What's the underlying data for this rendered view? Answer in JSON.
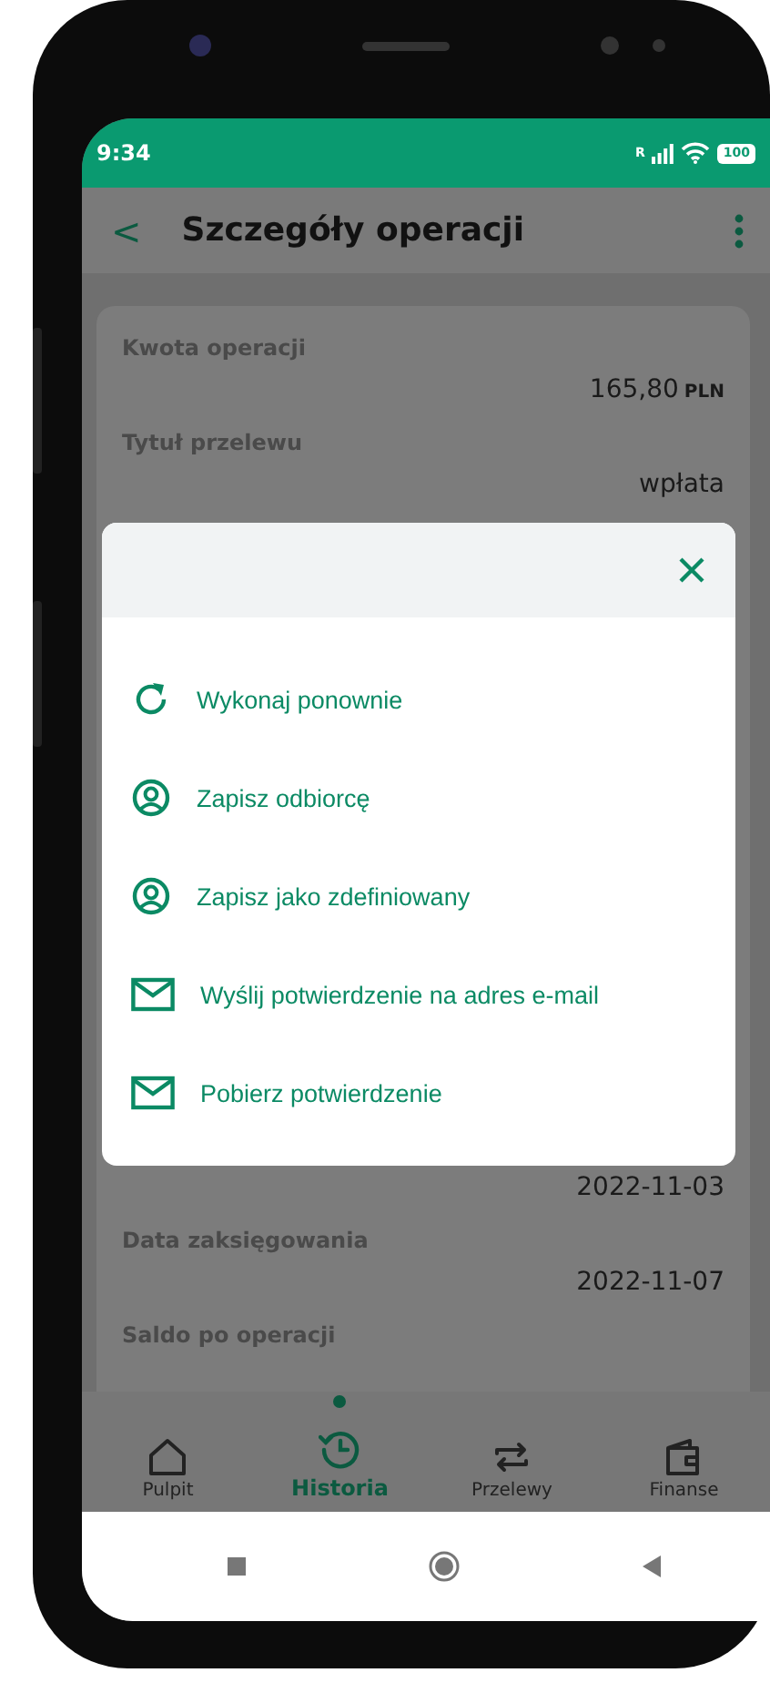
{
  "status_bar": {
    "time": "9:34",
    "roaming": "R",
    "battery": "100"
  },
  "app_bar": {
    "back": "<",
    "title": "Szczegóły operacji"
  },
  "details": [
    {
      "label": "Kwota operacji",
      "amount": "165,80",
      "currency": "PLN"
    },
    {
      "label": "Tytuł przelewu",
      "value": "wpłata"
    }
  ],
  "details_below": [
    {
      "value": "2022-11-03"
    },
    {
      "label": "Data zaksięgowania",
      "value": "2022-11-07"
    },
    {
      "label": "Saldo po operacji"
    }
  ],
  "dialog": {
    "items": [
      {
        "kind": "repeat",
        "label": "Wykonaj ponownie"
      },
      {
        "kind": "person",
        "label": "Zapisz odbiorcę"
      },
      {
        "kind": "person",
        "label": "Zapisz jako zdefiniowany"
      },
      {
        "kind": "mail",
        "label": "Wyślij potwierdzenie na adres e-mail"
      },
      {
        "kind": "mail",
        "label": "Pobierz potwierdzenie"
      }
    ]
  },
  "bottom_nav": [
    {
      "kind": "home",
      "label": "Pulpit",
      "selected": false
    },
    {
      "kind": "history",
      "label": "Historia",
      "selected": true
    },
    {
      "kind": "transfer",
      "label": "Przelewy",
      "selected": false
    },
    {
      "kind": "wallet",
      "label": "Finanse",
      "selected": false
    }
  ]
}
